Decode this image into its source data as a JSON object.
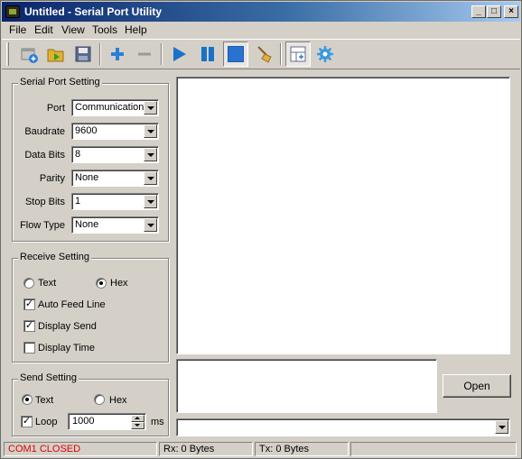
{
  "window": {
    "title": "Untitled - Serial Port Utility",
    "min_glyph": "_",
    "max_glyph": "□",
    "close_glyph": "×"
  },
  "menu": [
    "File",
    "Edit",
    "View",
    "Tools",
    "Help"
  ],
  "toolbar": {
    "icons": [
      "new-icon",
      "open-folder-icon",
      "save-icon",
      "add-icon",
      "remove-icon",
      "play-icon",
      "pause-icon",
      "stop-icon",
      "clear-broom-icon",
      "layout-icon",
      "settings-gear-icon"
    ]
  },
  "serial_port": {
    "title": "Serial Port Setting",
    "port_label": "Port",
    "port_value": "Communications",
    "baud_label": "Baudrate",
    "baud_value": "9600",
    "databits_label": "Data Bits",
    "databits_value": "8",
    "parity_label": "Parity",
    "parity_value": "None",
    "stopbits_label": "Stop Bits",
    "stopbits_value": "1",
    "flow_label": "Flow Type",
    "flow_value": "None"
  },
  "receive": {
    "title": "Receive Setting",
    "text_label": "Text",
    "hex_label": "Hex",
    "selected": "Hex",
    "auto_feed_label": "Auto Feed Line",
    "auto_feed": true,
    "display_send_label": "Display Send",
    "display_send": true,
    "display_time_label": "Display Time",
    "display_time": false
  },
  "send": {
    "title": "Send Setting",
    "text_label": "Text",
    "hex_label": "Hex",
    "selected": "Text",
    "loop_label": "Loop",
    "loop": true,
    "loop_value": "1000",
    "unit": "ms"
  },
  "open_button": "Open",
  "status": {
    "port": "COM1 CLOSED",
    "port_color": "#e00000",
    "rx": "Rx: 0 Bytes",
    "tx": "Tx: 0 Bytes"
  }
}
